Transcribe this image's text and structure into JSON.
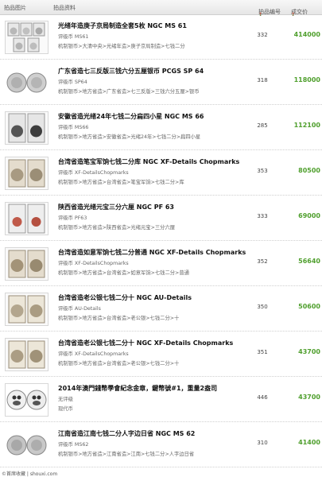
{
  "header": {
    "col_image": "拍品图片",
    "col_info": "拍品资料",
    "col_number": "拍品编号",
    "col_price": "成交价"
  },
  "rows": [
    {
      "title": "光绪年造庚子京局制造全套5枚 NGC MS 61",
      "grade": "评级币 MS61",
      "category": "机制银币>大清中央>光绪年造>庚子京局制造>七钱二分",
      "lot": "332",
      "price": "414000"
    },
    {
      "title": "广东省造七三反版三钱六分五厘银币 PCGS SP 64",
      "grade": "评级币 SP64",
      "category": "机制银币>地方省造>广东省造>七三反版>三钱六分五厘>银币",
      "lot": "318",
      "price": "118000"
    },
    {
      "title": "安徽省造光绪24年七钱二分扁四小星 NGC MS 66",
      "grade": "评级币 MS66",
      "category": "机制银币>地方省造>安徽省造>光绪24年>七钱二分>扁四小星",
      "lot": "285",
      "price": "112100"
    },
    {
      "title": "台湾省造笔宝军饷七钱二分库 NGC XF-Details Chopmarks",
      "grade": "评级币 XF-DetailsChopmarks",
      "category": "机制银币>地方省造>台湾省造>笔宝军饷>七钱二分>库",
      "lot": "353",
      "price": "80500"
    },
    {
      "title": "陕西省造光绪元宝三分六厘 NGC PF 63",
      "grade": "评级币 PF63",
      "category": "机制银币>地方省造>陕西省造>光绪元宝>三分六厘",
      "lot": "333",
      "price": "69000"
    },
    {
      "title": "台湾省造如意军饷七钱二分普通 NGC XF-Details Chopmarks",
      "grade": "评级币 XF-DetailsChopmarks",
      "category": "机制银币>地方省造>台湾省造>如意军饷>七钱二分>普通",
      "lot": "352",
      "price": "56640"
    },
    {
      "title": "台湾省造老公银七钱二分十 NGC AU-Details",
      "grade": "评级币 AU-Details",
      "category": "机制银币>地方省造>台湾省造>老公银>七钱二分>十",
      "lot": "350",
      "price": "50600"
    },
    {
      "title": "台湾省造老公银七钱二分十 NGC XF-Details Chopmarks",
      "grade": "评级币 XF-DetailsChopmarks",
      "category": "机制银币>地方省造>台湾省造>老公银>七钱二分>十",
      "lot": "351",
      "price": "43700"
    },
    {
      "title": "2014年澳門錢幣學會紀念金章，鍵幣號#1，重量2盎司",
      "grade": "无评级",
      "category": "现代币",
      "lot": "446",
      "price": "43700"
    },
    {
      "title": "江南省造江南七钱二分人字边日省 NGC MS 62",
      "grade": "评级币 MS62",
      "category": "机制银币>地方省造>江南省造>江南>七钱二分>人字边日省",
      "lot": "310",
      "price": "41400"
    }
  ],
  "watermark": "©首席收藏 | shouxi.com"
}
